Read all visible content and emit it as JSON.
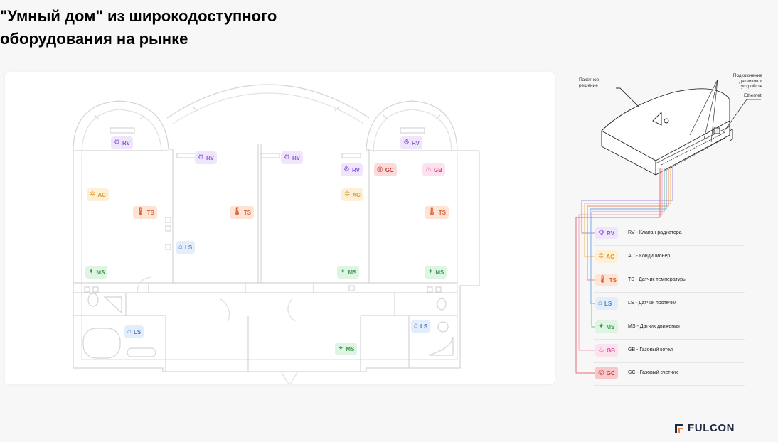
{
  "title": "\"Умный дом\" из широкодоступного оборудования на рынке",
  "colors": {
    "rv": "#8a55d8",
    "ac": "#e09a2a",
    "ts": "#dc6030",
    "ls": "#4b7cd0",
    "ms": "#3a9b54",
    "gb": "#d94a8a",
    "gc": "#cc3333"
  },
  "plan": {
    "badges": {
      "rv1": "RV",
      "rv2": "RV",
      "rv3": "RV",
      "rv4": "RV",
      "rv5": "RV",
      "ac1": "AC",
      "ac2": "AC",
      "ts1": "TS",
      "ts2": "TS",
      "ts3": "TS",
      "ls1": "LS",
      "ls2": "LS",
      "ls3": "LS",
      "ms1": "MS",
      "ms2": "MS",
      "ms3": "MS",
      "ms4": "MS",
      "gc1": "GC",
      "gb1": "GB"
    }
  },
  "hub": {
    "label_package": "Пакетное решение",
    "label_sensors": "Подключение датчиков и устройств",
    "label_ethernet": "Ethernet"
  },
  "legend": [
    {
      "code": "RV",
      "text": "RV - Клапан радиатора"
    },
    {
      "code": "AC",
      "text": "AC - Кондиционер"
    },
    {
      "code": "TS",
      "text": "TS - Датчик температуры"
    },
    {
      "code": "LS",
      "text": "LS - Датчик протечки"
    },
    {
      "code": "MS",
      "text": "MS - Датчик движения"
    },
    {
      "code": "GB",
      "text": "GB - Газовый котел"
    },
    {
      "code": "GC",
      "text": "GC - Газовый счетчик"
    }
  ],
  "brand": "FULCON"
}
